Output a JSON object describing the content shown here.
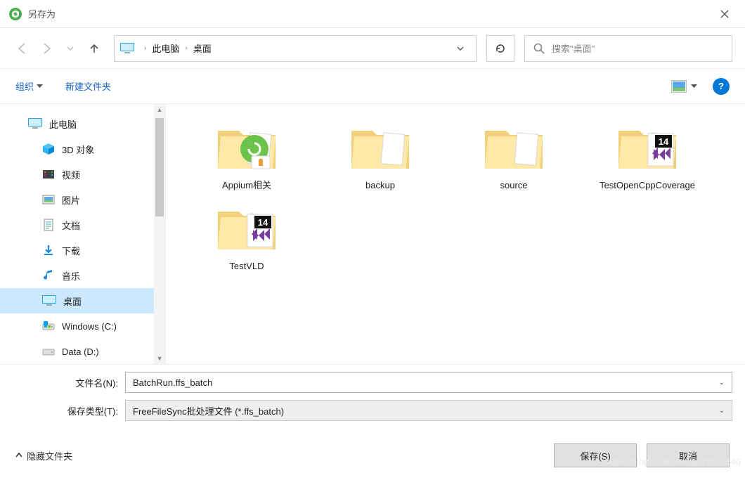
{
  "window": {
    "title": "另存为"
  },
  "breadcrumb": {
    "root": "此电脑",
    "current": "桌面"
  },
  "search": {
    "placeholder": "搜索\"桌面\""
  },
  "toolbar": {
    "organize": "组织",
    "new_folder": "新建文件夹",
    "help": "?"
  },
  "tree": {
    "root": "此电脑",
    "items": [
      {
        "label": "3D 对象",
        "icon": "cube"
      },
      {
        "label": "视频",
        "icon": "video"
      },
      {
        "label": "图片",
        "icon": "image"
      },
      {
        "label": "文档",
        "icon": "doc"
      },
      {
        "label": "下载",
        "icon": "download"
      },
      {
        "label": "音乐",
        "icon": "music"
      },
      {
        "label": "桌面",
        "icon": "desktop",
        "selected": true
      },
      {
        "label": "Windows (C:)",
        "icon": "drive-win"
      },
      {
        "label": "Data (D:)",
        "icon": "drive"
      }
    ]
  },
  "content": {
    "items": [
      {
        "label": "Appium相关",
        "variant": "green"
      },
      {
        "label": "backup",
        "variant": "plain"
      },
      {
        "label": "source",
        "variant": "plain"
      },
      {
        "label": "TestOpenCppCoverage",
        "variant": "vs14"
      },
      {
        "label": "TestVLD",
        "variant": "vs14"
      }
    ]
  },
  "fields": {
    "filename_label": "文件名(N):",
    "filename_value": "BatchRun.ffs_batch",
    "filetype_label": "保存类型(T):",
    "filetype_value": "FreeFileSync批处理文件 (*.ffs_batch)"
  },
  "footer": {
    "hide_folders": "隐藏文件夹",
    "save": "保存(S)",
    "cancel": "取消"
  },
  "watermark": "https://blog.csdn.net/xp178171640"
}
